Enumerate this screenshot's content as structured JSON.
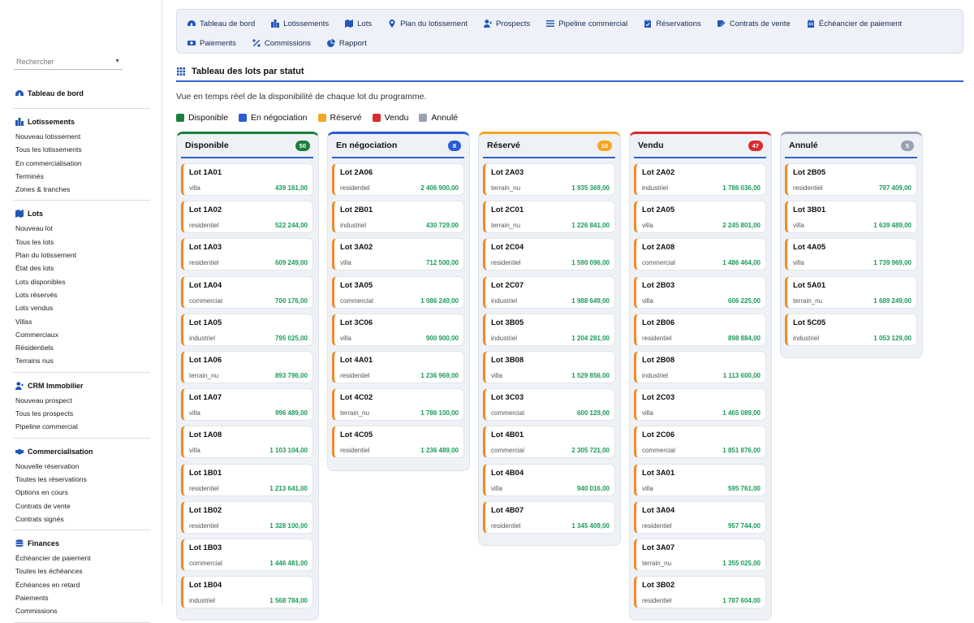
{
  "sidebar": {
    "search_placeholder": "Rechercher",
    "sections": [
      {
        "icon": "gauge-icon",
        "title": "Tableau de bord",
        "items": []
      },
      {
        "icon": "city-icon",
        "title": "Lotissements",
        "items": [
          "Nouveau lotissement",
          "Tous les lotissements",
          "En commercialisation",
          "Terminés",
          "Zones & tranches"
        ]
      },
      {
        "icon": "map-icon",
        "title": "Lots",
        "items": [
          "Nouveau lot",
          "Tous les lots",
          "Plan du lotissement",
          "État des lots",
          "Lots disponibles",
          "Lots réservés",
          "Lots vendus",
          "Villas",
          "Commerciaux",
          "Résidentiels",
          "Terrains nus"
        ]
      },
      {
        "icon": "user-plus-icon",
        "title": "CRM Immobilier",
        "items": [
          "Nouveau prospect",
          "Tous les prospects",
          "Pipeline commercial"
        ]
      },
      {
        "icon": "handshake-icon",
        "title": "Commercialisation",
        "items": [
          "Nouvelle réservation",
          "Toutes les réservations",
          "Options en cours",
          "Contrats de vente",
          "Contrats signés"
        ]
      },
      {
        "icon": "coins-icon",
        "title": "Finances",
        "items": [
          "Échéancier de paiement",
          "Toutes les échéances",
          "Échéances en retard",
          "Paiements",
          "Commissions"
        ]
      }
    ]
  },
  "topnav": [
    {
      "icon": "gauge-icon",
      "label": "Tableau de bord"
    },
    {
      "icon": "city-icon",
      "label": "Lotissements"
    },
    {
      "icon": "map-icon",
      "label": "Lots"
    },
    {
      "icon": "map-pin-icon",
      "label": "Plan du lotissement"
    },
    {
      "icon": "user-plus-icon",
      "label": "Prospects"
    },
    {
      "icon": "bars-icon",
      "label": "Pipeline commercial"
    },
    {
      "icon": "calendar-check-icon",
      "label": "Réservations"
    },
    {
      "icon": "signature-icon",
      "label": "Contrats de vente"
    },
    {
      "icon": "calendar-icon",
      "label": "Échéancier de paiement"
    },
    {
      "icon": "money-icon",
      "label": "Paiements"
    },
    {
      "icon": "percent-icon",
      "label": "Commissions"
    },
    {
      "icon": "pie-chart-icon",
      "label": "Rapport"
    }
  ],
  "page": {
    "title": "Tableau des lots par statut",
    "subtitle": "Vue en temps réel de la disponibilité de chaque lot du programme."
  },
  "legend": [
    {
      "label": "Disponible",
      "color": "#1a7f3c"
    },
    {
      "label": "En négociation",
      "color": "#2d5bd6"
    },
    {
      "label": "Réservé",
      "color": "#f5a623"
    },
    {
      "label": "Vendu",
      "color": "#d92c2c"
    },
    {
      "label": "Annulé",
      "color": "#98a2b3"
    }
  ],
  "columns": [
    {
      "title": "Disponible",
      "count": "50",
      "color": "#1a7f3c",
      "cards": [
        {
          "name": "Lot 1A01",
          "type": "villa",
          "price": "439 161,00"
        },
        {
          "name": "Lot 1A02",
          "type": "residentiel",
          "price": "522 244,00"
        },
        {
          "name": "Lot 1A03",
          "type": "residentiel",
          "price": "609 249,00"
        },
        {
          "name": "Lot 1A04",
          "type": "commercial",
          "price": "700 176,00"
        },
        {
          "name": "Lot 1A05",
          "type": "industriel",
          "price": "795 025,00"
        },
        {
          "name": "Lot 1A06",
          "type": "terrain_nu",
          "price": "893 796,00"
        },
        {
          "name": "Lot 1A07",
          "type": "villa",
          "price": "996 489,00"
        },
        {
          "name": "Lot 1A08",
          "type": "villa",
          "price": "1 103 104,00"
        },
        {
          "name": "Lot 1B01",
          "type": "residentiel",
          "price": "1 213 641,00"
        },
        {
          "name": "Lot 1B02",
          "type": "residentiel",
          "price": "1 328 100,00"
        },
        {
          "name": "Lot 1B03",
          "type": "commercial",
          "price": "1 446 481,00"
        },
        {
          "name": "Lot 1B04",
          "type": "industriel",
          "price": "1 568 784,00"
        }
      ]
    },
    {
      "title": "En négociation",
      "count": "8",
      "color": "#2d5bd6",
      "cards": [
        {
          "name": "Lot 2A06",
          "type": "residentiel",
          "price": "2 406 900,00"
        },
        {
          "name": "Lot 2B01",
          "type": "industriel",
          "price": "430 729,00"
        },
        {
          "name": "Lot 3A02",
          "type": "villa",
          "price": "712 500,00"
        },
        {
          "name": "Lot 3A05",
          "type": "commercial",
          "price": "1 086 249,00"
        },
        {
          "name": "Lot 3C06",
          "type": "villa",
          "price": "900 900,00"
        },
        {
          "name": "Lot 4A01",
          "type": "residentiel",
          "price": "1 236 969,00"
        },
        {
          "name": "Lot 4C02",
          "type": "terrain_nu",
          "price": "1 786 100,00"
        },
        {
          "name": "Lot 4C05",
          "type": "residentiel",
          "price": "1 236 489,00"
        }
      ]
    },
    {
      "title": "Réservé",
      "count": "10",
      "color": "#f5a623",
      "cards": [
        {
          "name": "Lot 2A03",
          "type": "terrain_nu",
          "price": "1 935 369,00"
        },
        {
          "name": "Lot 2C01",
          "type": "terrain_nu",
          "price": "1 226 841,00"
        },
        {
          "name": "Lot 2C04",
          "type": "residentiel",
          "price": "1 590 096,00"
        },
        {
          "name": "Lot 2C07",
          "type": "industriel",
          "price": "1 988 649,00"
        },
        {
          "name": "Lot 3B05",
          "type": "industriel",
          "price": "1 204 281,00"
        },
        {
          "name": "Lot 3B08",
          "type": "villa",
          "price": "1 529 856,00"
        },
        {
          "name": "Lot 3C03",
          "type": "commercial",
          "price": "600 129,00"
        },
        {
          "name": "Lot 4B01",
          "type": "commercial",
          "price": "2 305 721,00"
        },
        {
          "name": "Lot 4B04",
          "type": "villa",
          "price": "940 016,00"
        },
        {
          "name": "Lot 4B07",
          "type": "residentiel",
          "price": "1 345 409,00"
        }
      ]
    },
    {
      "title": "Vendu",
      "count": "47",
      "color": "#d92c2c",
      "cards": [
        {
          "name": "Lot 2A02",
          "type": "industriel",
          "price": "1 786 036,00"
        },
        {
          "name": "Lot 2A05",
          "type": "villa",
          "price": "2 245 801,00"
        },
        {
          "name": "Lot 2A08",
          "type": "commercial",
          "price": "1 486 464,00"
        },
        {
          "name": "Lot 2B03",
          "type": "villa",
          "price": "606 225,00"
        },
        {
          "name": "Lot 2B06",
          "type": "residentiel",
          "price": "898 884,00"
        },
        {
          "name": "Lot 2B08",
          "type": "industriel",
          "price": "1 113 600,00"
        },
        {
          "name": "Lot 2C03",
          "type": "villa",
          "price": "1 465 089,00"
        },
        {
          "name": "Lot 2C06",
          "type": "commercial",
          "price": "1 851 876,00"
        },
        {
          "name": "Lot 3A01",
          "type": "villa",
          "price": "595 761,00"
        },
        {
          "name": "Lot 3A04",
          "type": "residentiel",
          "price": "957 744,00"
        },
        {
          "name": "Lot 3A07",
          "type": "terrain_nu",
          "price": "1 355 025,00"
        },
        {
          "name": "Lot 3B02",
          "type": "residentiel",
          "price": "1 787 604,00"
        }
      ]
    },
    {
      "title": "Annulé",
      "count": "5",
      "color": "#98a2b3",
      "cards": [
        {
          "name": "Lot 2B05",
          "type": "residentiel",
          "price": "797 409,00"
        },
        {
          "name": "Lot 3B01",
          "type": "villa",
          "price": "1 639 489,00"
        },
        {
          "name": "Lot 4A05",
          "type": "villa",
          "price": "1 739 969,00"
        },
        {
          "name": "Lot 5A01",
          "type": "terrain_nu",
          "price": "1 689 249,00"
        },
        {
          "name": "Lot 5C05",
          "type": "industriel",
          "price": "1 053 129,00"
        }
      ]
    }
  ]
}
